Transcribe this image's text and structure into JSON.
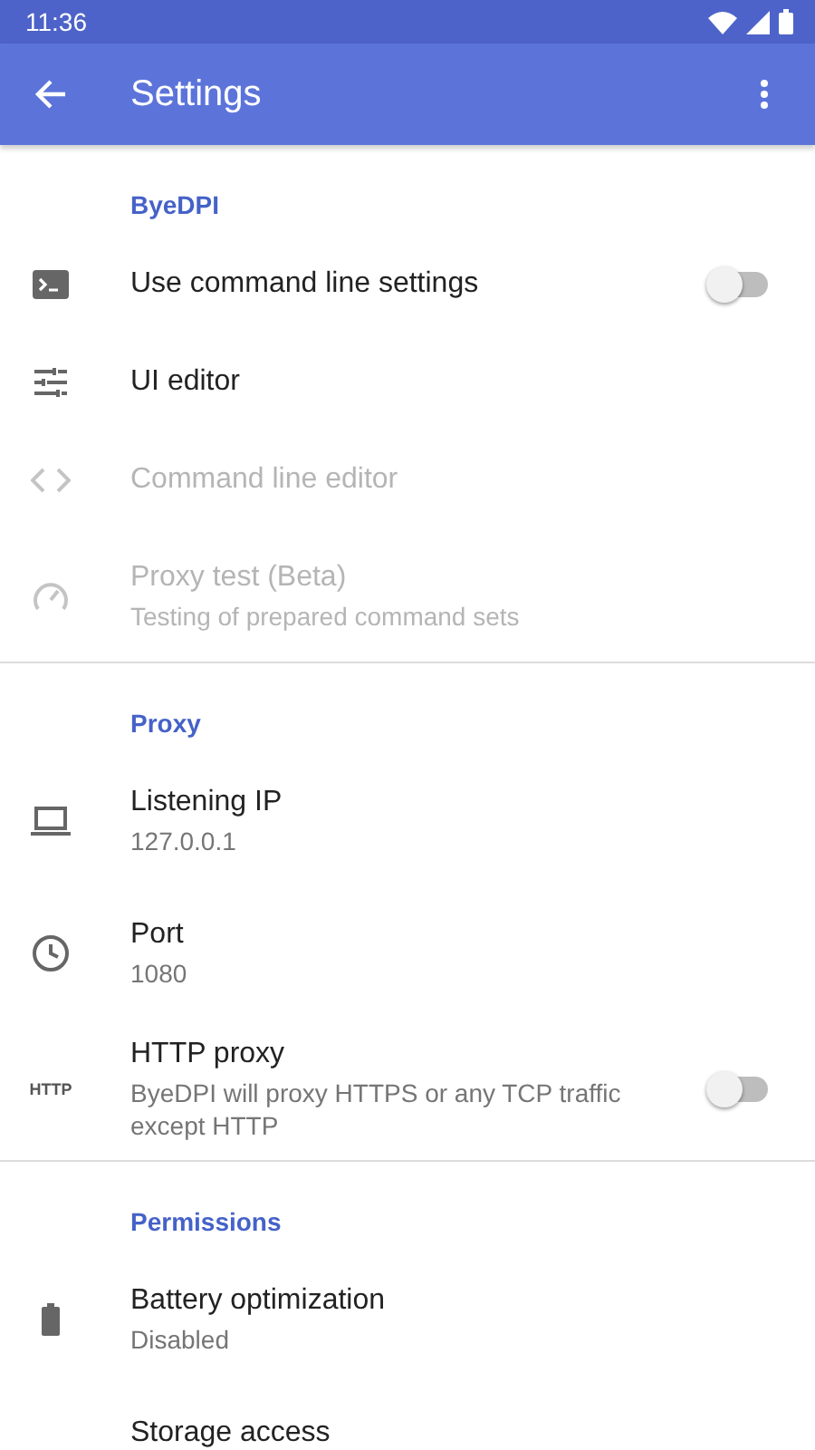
{
  "status_bar": {
    "time": "11:36"
  },
  "toolbar": {
    "title": "Settings"
  },
  "sections": [
    {
      "title": "ByeDPI",
      "items": [
        {
          "kind": "switch",
          "title": "Use command line settings",
          "disabled": false,
          "on": false
        },
        {
          "kind": "plain",
          "title": "UI editor",
          "disabled": false
        },
        {
          "kind": "plain",
          "title": "Command line editor",
          "disabled": true
        },
        {
          "kind": "plain",
          "title": "Proxy test (Beta)",
          "summary": "Testing of prepared command sets",
          "disabled": true
        }
      ]
    },
    {
      "title": "Proxy",
      "items": [
        {
          "kind": "plain",
          "title": "Listening IP",
          "summary": "127.0.0.1",
          "disabled": false
        },
        {
          "kind": "plain",
          "title": "Port",
          "summary": "1080",
          "disabled": false
        },
        {
          "kind": "switch",
          "icon_text": "HTTP",
          "title": "HTTP proxy",
          "summary": "ByeDPI will proxy HTTPS or any TCP traffic except HTTP",
          "disabled": false,
          "on": false
        }
      ]
    },
    {
      "title": "Permissions",
      "items": [
        {
          "kind": "plain",
          "title": "Battery optimization",
          "summary": "Disabled",
          "disabled": false
        },
        {
          "kind": "plain",
          "title": "Storage access",
          "disabled": false
        }
      ]
    }
  ]
}
